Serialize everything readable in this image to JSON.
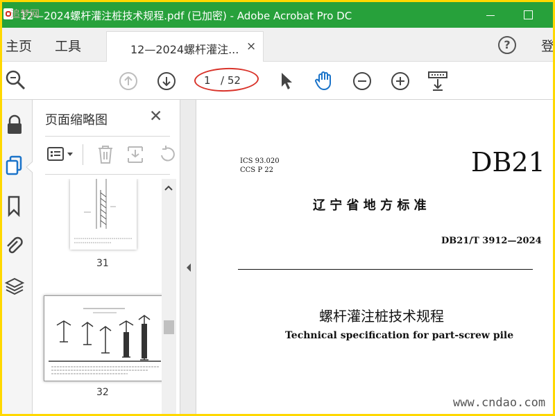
{
  "window": {
    "title": "12—2024螺杆灌注桩技术规程.pdf  (已加密)  - Adobe Acrobat Pro DC",
    "watermark_overlay": "追梦网"
  },
  "nav": {
    "home": "主页",
    "tools": "工具",
    "login": "登"
  },
  "tab": {
    "label": "12—2024螺杆灌注...",
    "close": "×"
  },
  "toolbar": {
    "current_page": "1",
    "total_pages": "/ 52"
  },
  "sidebar_panel": {
    "title": "页面缩略图",
    "thumbnails": [
      {
        "label": "31"
      },
      {
        "label": "32"
      }
    ]
  },
  "document": {
    "ics": "ICS 93.020",
    "ccs": "CCS P 22",
    "code": "DB21",
    "authority": "辽 宁 省 地 方 标 准",
    "standard_no": "DB21/T 3912—2024",
    "title_cn": "螺杆灌注桩技术规程",
    "title_en": "Technical specification for part-screw pile"
  },
  "site_watermark": "www.cndao.com",
  "colors": {
    "titlebar": "#27a13b",
    "accent_blue": "#1a73c9",
    "highlight_red": "#d9332a",
    "outer_border": "#ffd800"
  },
  "icons": [
    "search-icon",
    "arrow-up-icon",
    "arrow-down-icon",
    "cursor-icon",
    "hand-icon",
    "zoom-out-icon",
    "zoom-in-icon",
    "scroll-mode-icon",
    "lock-icon",
    "pages-icon",
    "bookmark-icon",
    "attachment-icon",
    "layers-icon",
    "options-icon",
    "trash-icon",
    "extract-icon",
    "rotate-icon"
  ]
}
